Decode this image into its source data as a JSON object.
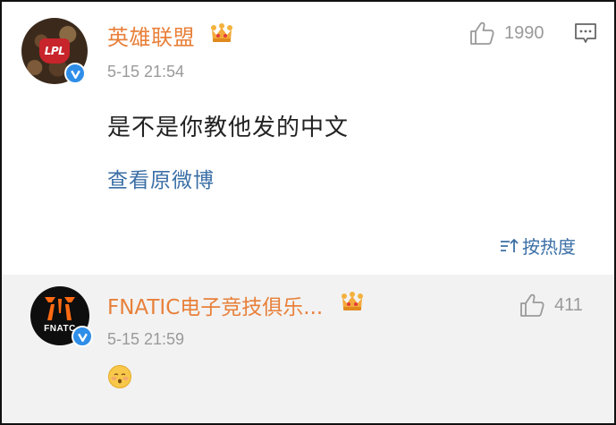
{
  "comment": {
    "username": "英雄联盟",
    "timestamp": "5-15 21:54",
    "like_count": "1990",
    "text": "是不是你教他发的中文",
    "view_original": "查看原微博",
    "avatar_text": "LPL"
  },
  "sort": {
    "label": "按热度"
  },
  "reply": {
    "username": "FNATIC电子竞技俱乐...",
    "timestamp": "5-15 21:59",
    "like_count": "411",
    "avatar_text": "FNATC"
  },
  "colors": {
    "username": "#e8803a",
    "link": "#3b6fa6",
    "meta": "#9a9a9a",
    "verified": "#2f8ee8",
    "reply_bg": "#f2f2f2"
  },
  "icons": {
    "verified": "verified-v-icon",
    "crown": "vip-crown-icon",
    "like": "thumbs-up-icon",
    "reply": "comment-bubble-icon",
    "sort": "sort-arrows-icon",
    "emoji": "face-emoji-icon"
  }
}
